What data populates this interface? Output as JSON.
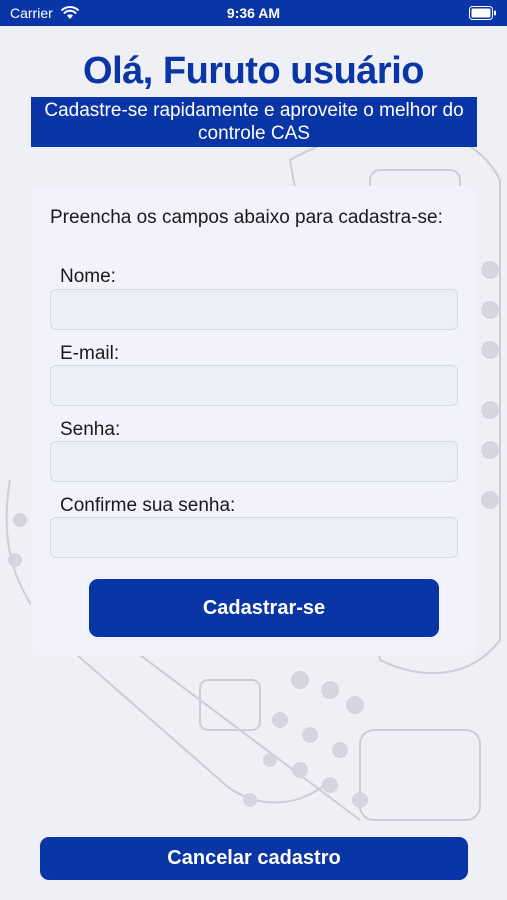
{
  "status_bar": {
    "carrier": "Carrier",
    "time": "9:36 AM",
    "icons": [
      "wifi-icon",
      "battery-icon"
    ]
  },
  "header": {
    "title": "Olá, Furuto usuário",
    "subtitle": "Cadastre-se rapidamente e aproveite o melhor do controle CAS"
  },
  "form": {
    "intro": "Preencha os campos abaixo para cadastra-se:",
    "fields": [
      {
        "label": "Nome:",
        "value": ""
      },
      {
        "label": "E-mail:",
        "value": ""
      },
      {
        "label": "Senha:",
        "value": ""
      },
      {
        "label": "Confirme sua senha:",
        "value": ""
      }
    ],
    "submit_label": "Cadastrar-se"
  },
  "footer": {
    "cancel_label": "Cancelar cadastro"
  },
  "colors": {
    "brand": "#0a35a6",
    "background": "#eff0f5",
    "card": "#f1f2fb"
  }
}
